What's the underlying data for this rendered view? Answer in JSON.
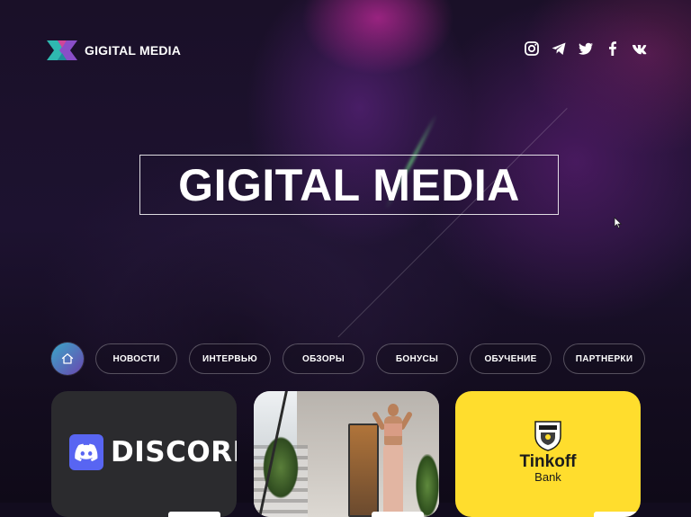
{
  "brand": {
    "logo_text": "GIGITAL MEDIA",
    "logo_colors": {
      "teal": "#2fb8b0",
      "purple": "#8a4ec8",
      "pink": "#d0459a"
    }
  },
  "socials": [
    {
      "icon": "instagram-icon"
    },
    {
      "icon": "telegram-icon"
    },
    {
      "icon": "twitter-icon"
    },
    {
      "icon": "facebook-icon"
    },
    {
      "icon": "vk-icon"
    }
  ],
  "hero": {
    "title": "GIGITAL MEDIA"
  },
  "nav": {
    "home_icon": "home-icon",
    "items": [
      {
        "label": "НОВОСТИ"
      },
      {
        "label": "ИНТЕРВЬЮ"
      },
      {
        "label": "ОБЗОРЫ"
      },
      {
        "label": "БОНУСЫ"
      },
      {
        "label": "ОБУЧЕНИЕ"
      },
      {
        "label": "ПАРТНЕРКИ"
      }
    ]
  },
  "cards": [
    {
      "name": "discord",
      "logo_text": "DISCORD",
      "background": "#2b2b2e",
      "accent": "#5865f2"
    },
    {
      "name": "fitness-photo",
      "background": "#cfcac4"
    },
    {
      "name": "tinkoff",
      "logo_title": "Tinkoff",
      "logo_sub": "Bank",
      "background": "#ffdd2d"
    }
  ]
}
